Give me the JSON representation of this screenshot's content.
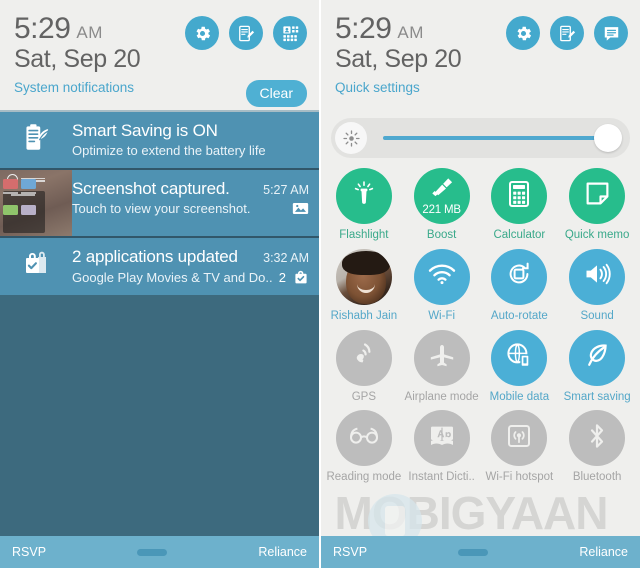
{
  "left_panel": {
    "header": {
      "time": "5:29",
      "ampm": "AM",
      "date": "Sat, Sep 20",
      "subtitle": "System notifications",
      "clear_label": "Clear",
      "icons": [
        "settings-gear-icon",
        "edit-note-icon",
        "contacts-grid-icon"
      ]
    },
    "notifications": [
      {
        "icon": "battery-leaf-icon",
        "title": "Smart Saving is ON",
        "subtitle": "Optimize to extend the battery life",
        "time": "",
        "count": "",
        "right_icon": ""
      },
      {
        "icon": "screenshot-thumbnail",
        "title": "Screenshot captured.",
        "subtitle": "Touch to view your screenshot.",
        "time": "5:27 AM",
        "count": "",
        "right_icon": "image-icon"
      },
      {
        "icon": "play-store-bag-icon",
        "title": "2 applications updated",
        "subtitle": "Google Play Movies & TV and Do..",
        "time": "3:32 AM",
        "count": "2",
        "right_icon": "bag-check-icon"
      }
    ],
    "navbar": {
      "carrier_left": "RSVP",
      "carrier_right": "Reliance"
    }
  },
  "right_panel": {
    "header": {
      "time": "5:29",
      "ampm": "AM",
      "date": "Sat, Sep 20",
      "subtitle": "Quick settings",
      "icons": [
        "settings-gear-icon",
        "edit-note-icon",
        "list-bubble-icon"
      ]
    },
    "brightness": {
      "icon": "brightness-icon",
      "value_percent": 94
    },
    "tiles": [
      {
        "label": "Flashlight",
        "icon": "flashlight-icon",
        "state": "on",
        "style": "green",
        "inner_text": ""
      },
      {
        "label": "Boost",
        "icon": "broom-icon",
        "state": "on",
        "style": "green",
        "inner_text": "221 MB"
      },
      {
        "label": "Calculator",
        "icon": "calculator-icon",
        "state": "on",
        "style": "green",
        "inner_text": ""
      },
      {
        "label": "Quick memo",
        "icon": "quick-memo-icon",
        "state": "on",
        "style": "green",
        "inner_text": ""
      },
      {
        "label": "Rishabh Jain",
        "icon": "user-avatar",
        "state": "on",
        "style": "avatar",
        "inner_text": ""
      },
      {
        "label": "Wi-Fi",
        "icon": "wifi-icon",
        "state": "on",
        "style": "blue",
        "inner_text": ""
      },
      {
        "label": "Auto-rotate",
        "icon": "auto-rotate-icon",
        "state": "on",
        "style": "blue",
        "inner_text": ""
      },
      {
        "label": "Sound",
        "icon": "sound-icon",
        "state": "on",
        "style": "blue",
        "inner_text": ""
      },
      {
        "label": "GPS",
        "icon": "gps-icon",
        "state": "off",
        "style": "gray",
        "inner_text": ""
      },
      {
        "label": "Airplane mode",
        "icon": "airplane-icon",
        "state": "off",
        "style": "gray",
        "inner_text": ""
      },
      {
        "label": "Mobile data",
        "icon": "mobile-data-icon",
        "state": "on",
        "style": "blue",
        "inner_text": ""
      },
      {
        "label": "Smart saving",
        "icon": "leaf-icon",
        "state": "on",
        "style": "blue",
        "inner_text": ""
      },
      {
        "label": "Reading mode",
        "icon": "glasses-icon",
        "state": "off",
        "style": "gray",
        "inner_text": ""
      },
      {
        "label": "Instant Dicti..",
        "icon": "dictionary-icon",
        "state": "off",
        "style": "gray",
        "inner_text": ""
      },
      {
        "label": "Wi-Fi hotspot",
        "icon": "hotspot-icon",
        "state": "off",
        "style": "gray",
        "inner_text": ""
      },
      {
        "label": "Bluetooth",
        "icon": "bluetooth-icon",
        "state": "off",
        "style": "gray",
        "inner_text": ""
      }
    ],
    "navbar": {
      "carrier_left": "RSVP",
      "carrier_right": "Reliance"
    }
  },
  "watermark": {
    "text": "MOBIGYAAN"
  },
  "colors": {
    "accent_blue": "#4bafd6",
    "accent_green": "#27bd8c",
    "off_gray": "#bdbdbd",
    "notification_bg": "#4f92b2",
    "shade_bg": "#3d6a7e",
    "panel_bg": "#efefed",
    "navbar_bg": "#6db1cc"
  }
}
